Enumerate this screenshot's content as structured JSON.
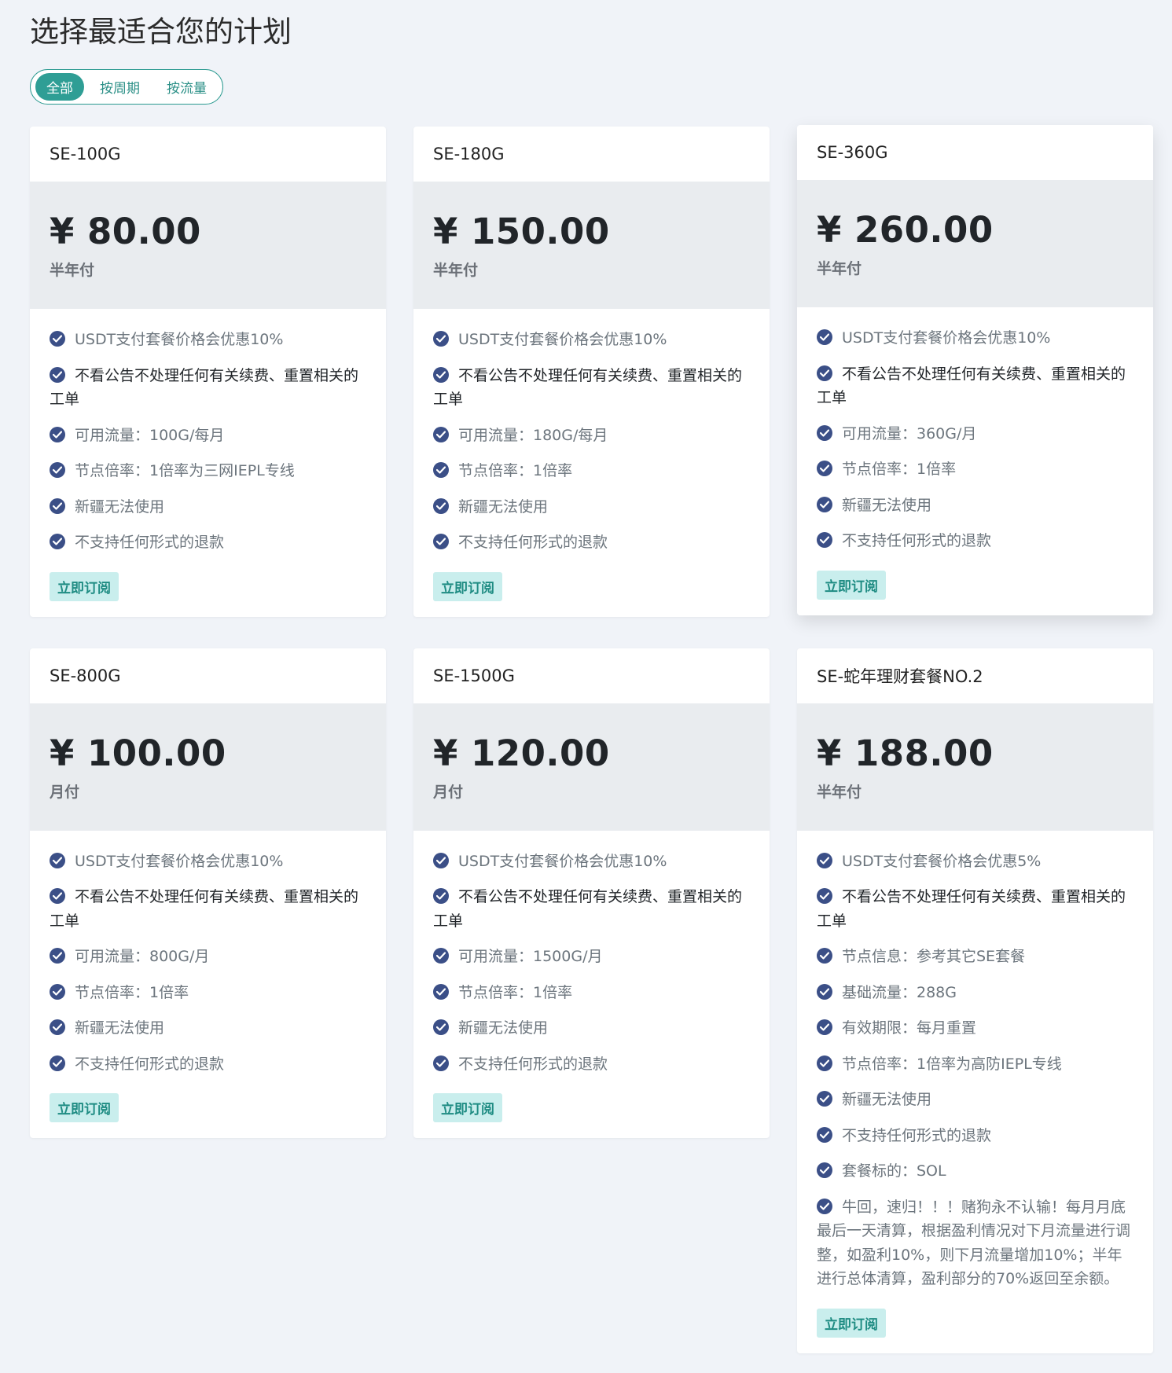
{
  "page": {
    "title": "选择最适合您的计划",
    "filters": [
      {
        "label": "全部",
        "active": true
      },
      {
        "label": "按周期",
        "active": false
      },
      {
        "label": "按流量",
        "active": false
      }
    ]
  },
  "colors": {
    "accent": "#2f9e95",
    "check": "#3b4f87",
    "subscribe_bg": "#c9eeed",
    "price_bg": "#e9ecef",
    "page_bg": "#f0f3f8"
  },
  "plans": [
    {
      "name": "SE-100G",
      "price": "¥ 80.00",
      "cycle": "半年付",
      "features": [
        "USDT支付套餐价格会优惠10%",
        "不看公告不处理任何有关续费、重置相关的工单",
        "可用流量：100G/每月",
        "节点倍率：1倍率为三网IEPL专线",
        "新疆无法使用",
        "不支持任何形式的退款"
      ],
      "button": "立即订阅"
    },
    {
      "name": "SE-180G",
      "price": "¥ 150.00",
      "cycle": "半年付",
      "features": [
        "USDT支付套餐价格会优惠10%",
        "不看公告不处理任何有关续费、重置相关的工单",
        "可用流量：180G/每月",
        "节点倍率：1倍率",
        "新疆无法使用",
        "不支持任何形式的退款"
      ],
      "button": "立即订阅"
    },
    {
      "name": "SE-360G",
      "price": "¥ 260.00",
      "cycle": "半年付",
      "features": [
        "USDT支付套餐价格会优惠10%",
        "不看公告不处理任何有关续费、重置相关的工单",
        "可用流量：360G/月",
        "节点倍率：1倍率",
        "新疆无法使用",
        "不支持任何形式的退款"
      ],
      "button": "立即订阅"
    },
    {
      "name": "SE-800G",
      "price": "¥ 100.00",
      "cycle": "月付",
      "features": [
        "USDT支付套餐价格会优惠10%",
        "不看公告不处理任何有关续费、重置相关的工单",
        "可用流量：800G/月",
        "节点倍率：1倍率",
        "新疆无法使用",
        "不支持任何形式的退款"
      ],
      "button": "立即订阅"
    },
    {
      "name": "SE-1500G",
      "price": "¥ 120.00",
      "cycle": "月付",
      "features": [
        "USDT支付套餐价格会优惠10%",
        "不看公告不处理任何有关续费、重置相关的工单",
        "可用流量：1500G/月",
        "节点倍率：1倍率",
        "新疆无法使用",
        "不支持任何形式的退款"
      ],
      "button": "立即订阅"
    },
    {
      "name": "SE-蛇年理财套餐NO.2",
      "price": "¥ 188.00",
      "cycle": "半年付",
      "features": [
        "USDT支付套餐价格会优惠5%",
        "不看公告不处理任何有关续费、重置相关的工单",
        "节点信息：参考其它SE套餐",
        "基础流量：288G",
        "有效期限：每月重置",
        "节点倍率：1倍率为高防IEPL专线",
        "新疆无法使用",
        "不支持任何形式的退款",
        "套餐标的：SOL",
        "牛回，速归！！！赌狗永不认输！每月月底最后一天清算，根据盈利情况对下月流量进行调整，如盈利10%，则下月流量增加10%；半年进行总体清算，盈利部分的70%返回至余额。"
      ],
      "button": "立即订阅"
    }
  ]
}
